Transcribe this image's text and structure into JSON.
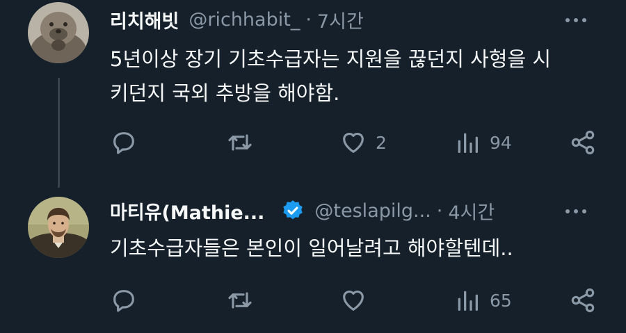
{
  "colors": {
    "background": "#15202b",
    "text": "#f7f9f9",
    "secondary_text": "#8b98a5",
    "verified_badge": "#1d9bf0",
    "thread_line": "#38444d"
  },
  "tweets": [
    {
      "display_name": "리치해빗",
      "handle": "@richhabit_",
      "separator": "·",
      "time": "7시간",
      "text_line1": "5년이상 장기 기초수급자는 지원을 끊던지 사형을 시",
      "text_line2": "키던지 국외 추방을 해야함.",
      "verified": false,
      "actions": {
        "reply_count": "",
        "retweet_count": "",
        "like_count": "2",
        "views_count": "94"
      },
      "icons": [
        "reply-icon",
        "retweet-icon",
        "like-icon",
        "views-icon",
        "share-icon",
        "more-icon"
      ]
    },
    {
      "display_name": "마티유(Mathie...",
      "handle": "@teslapilg...",
      "separator": "·",
      "time": "4시간",
      "text_line1": "기초수급자들은 본인이 일어날려고 해야할텐데..",
      "verified": true,
      "actions": {
        "reply_count": "",
        "retweet_count": "",
        "like_count": "",
        "views_count": "65"
      },
      "icons": [
        "reply-icon",
        "retweet-icon",
        "like-icon",
        "views-icon",
        "share-icon",
        "more-icon",
        "verified-badge-icon"
      ]
    }
  ]
}
